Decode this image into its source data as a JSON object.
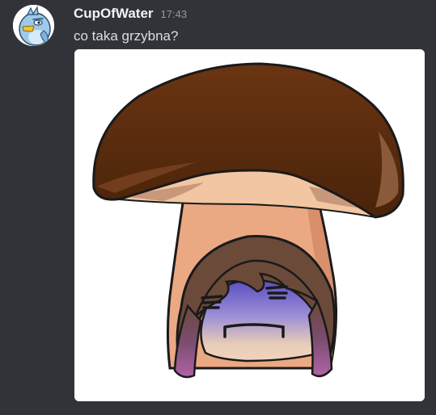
{
  "message": {
    "author": {
      "username": "CupOfWater",
      "avatar_icon": "bird-avatar-icon"
    },
    "timestamp": "17:43",
    "content": "co taka grzybna?",
    "attachment": {
      "type": "image",
      "depicts": "mushroom-character-image"
    }
  },
  "colors": {
    "background": "#313338",
    "username": "#f2f3f5",
    "timestamp": "#949ba4",
    "text": "#dbdee1",
    "mushroom_cap": "#5a2d0c",
    "mushroom_stem": "#e8a883",
    "hair": "#6b4a3a",
    "blush": "#6a5bc4"
  }
}
